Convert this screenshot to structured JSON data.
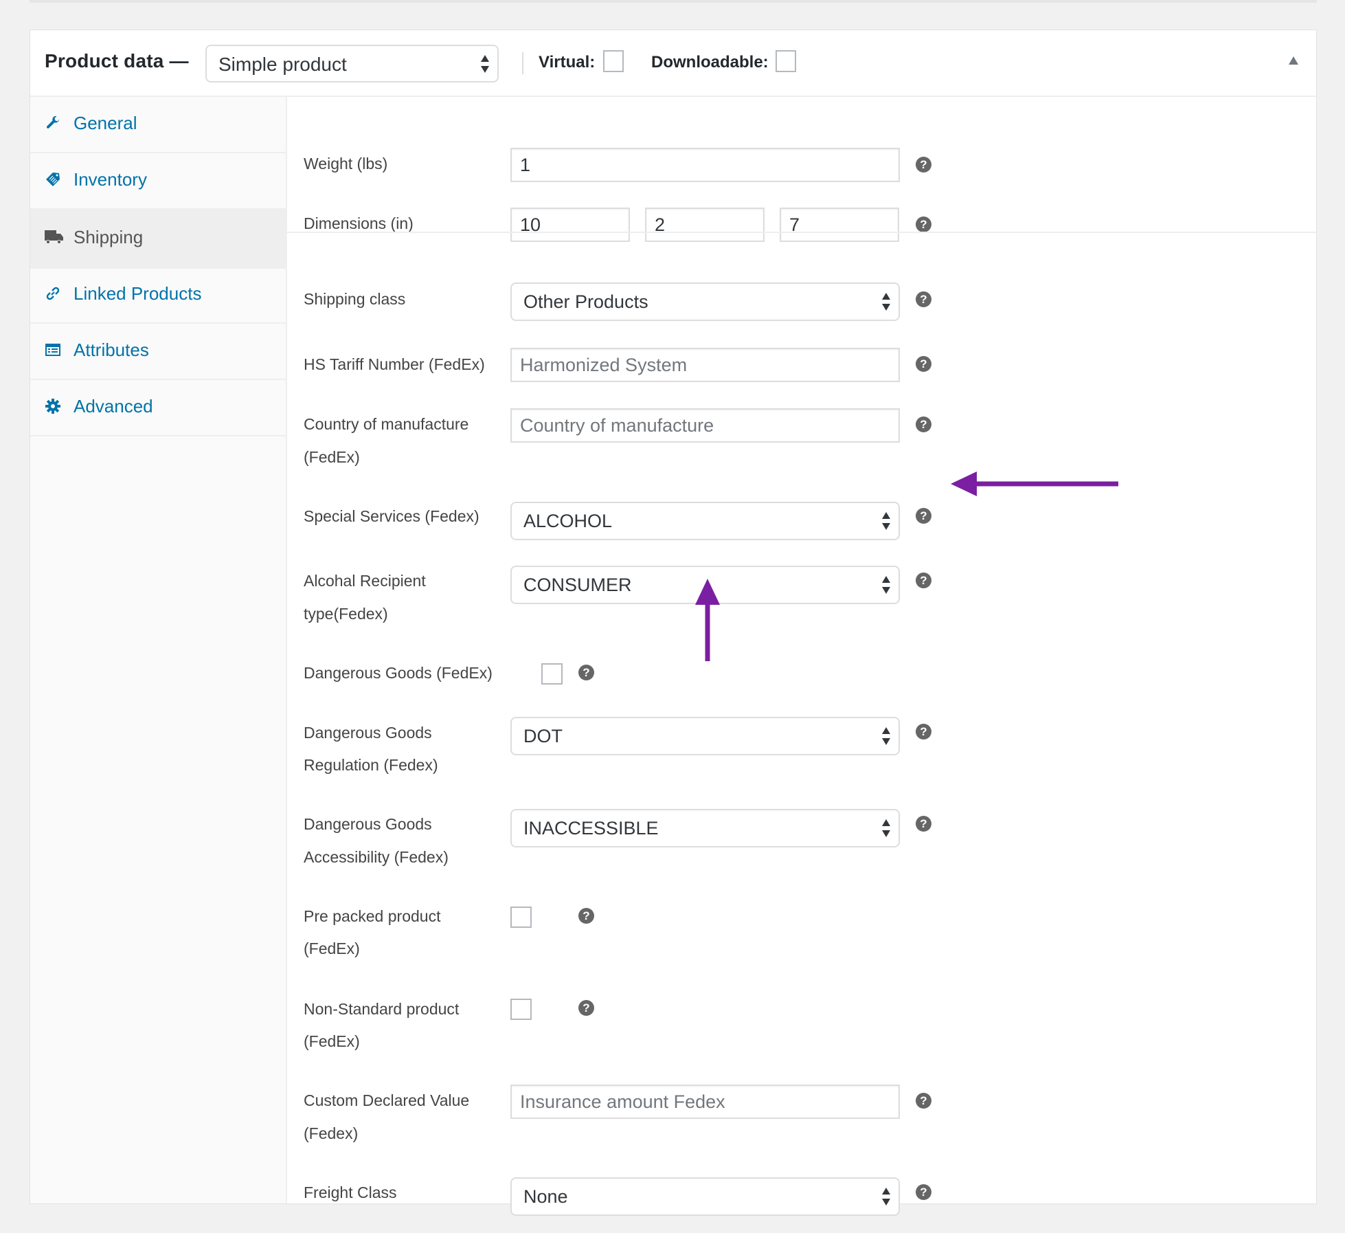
{
  "header": {
    "title": "Product data —",
    "product_type": "Simple product",
    "virtual_label": "Virtual:",
    "virtual_checked": false,
    "downloadable_label": "Downloadable:",
    "downloadable_checked": false
  },
  "sidebar": {
    "items": [
      {
        "label": "General",
        "icon": "wrench-icon",
        "active": false
      },
      {
        "label": "Inventory",
        "icon": "tag-icon",
        "active": false
      },
      {
        "label": "Shipping",
        "icon": "truck-icon",
        "active": true
      },
      {
        "label": "Linked Products",
        "icon": "link-icon",
        "active": false
      },
      {
        "label": "Attributes",
        "icon": "list-icon",
        "active": false
      },
      {
        "label": "Advanced",
        "icon": "gear-icon",
        "active": false
      }
    ]
  },
  "help_glyph": "?",
  "fields": {
    "weight": {
      "label": "Weight (lbs)",
      "value": "1"
    },
    "dimensions": {
      "label": "Dimensions (in)",
      "length": "10",
      "width": "2",
      "height": "7"
    },
    "shipping_class": {
      "label": "Shipping class",
      "value": "Other Products"
    },
    "hs_tariff": {
      "label": "HS Tariff Number (FedEx)",
      "placeholder": "Harmonized System",
      "value": ""
    },
    "country": {
      "label_line1": "Country of manufacture",
      "label_line2": "(FedEx)",
      "placeholder": "Country of manufacture",
      "value": ""
    },
    "special_services": {
      "label": "Special Services (Fedex)",
      "value": "ALCOHOL"
    },
    "alcohol_recipient": {
      "label_line1": "Alcohal Recipient",
      "label_line2": "type(Fedex)",
      "value": "CONSUMER"
    },
    "dangerous_goods": {
      "label": "Dangerous Goods (FedEx)",
      "checked": false
    },
    "dg_regulation": {
      "label_line1": "Dangerous Goods",
      "label_line2": "Regulation (Fedex)",
      "value": "DOT"
    },
    "dg_accessibility": {
      "label_line1": "Dangerous Goods",
      "label_line2": "Accessibility (Fedex)",
      "value": "INACCESSIBLE"
    },
    "pre_packed": {
      "label_line1": "Pre packed product",
      "label_line2": "(FedEx)",
      "checked": false
    },
    "non_standard": {
      "label_line1": "Non-Standard product",
      "label_line2": "(FedEx)",
      "checked": false
    },
    "custom_declared": {
      "label_line1": "Custom Declared Value",
      "label_line2": "(Fedex)",
      "placeholder": "Insurance amount Fedex",
      "value": ""
    },
    "freight_class": {
      "label": "Freight Class",
      "value": "None"
    }
  },
  "annotations": {
    "arrow_color": "#7b1fa2",
    "arrows": [
      {
        "points_to": "special-services-select",
        "direction": "left"
      },
      {
        "points_to": "alcohol-recipient-select",
        "direction": "up"
      }
    ]
  }
}
